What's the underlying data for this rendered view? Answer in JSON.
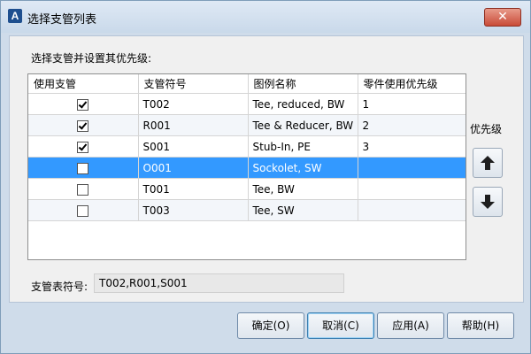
{
  "window": {
    "title": "选择支管列表",
    "app_icon": "autocad-a-icon",
    "close_icon": "close-icon",
    "close_glyph": "✕"
  },
  "dialog": {
    "prompt": "选择支管并设置其优先级:",
    "columns": [
      "使用支管",
      "支管符号",
      "图例名称",
      "零件使用优先级"
    ],
    "rows": [
      {
        "checked": true,
        "symbol": "T002",
        "legend": "Tee, reduced, BW",
        "priority": "1"
      },
      {
        "checked": true,
        "symbol": "R001",
        "legend": "Tee & Reducer, BW",
        "priority": "2"
      },
      {
        "checked": true,
        "symbol": "S001",
        "legend": "Stub-In, PE",
        "priority": "3"
      },
      {
        "checked": false,
        "symbol": "O001",
        "legend": "Sockolet, SW",
        "priority": "",
        "selected": true
      },
      {
        "checked": false,
        "symbol": "T001",
        "legend": "Tee, BW",
        "priority": ""
      },
      {
        "checked": false,
        "symbol": "T003",
        "legend": "Tee, SW",
        "priority": ""
      }
    ],
    "priority_label": "优先级",
    "move_up_icon": "arrow-up-icon",
    "move_down_icon": "arrow-down-icon",
    "symbols_label": "支管表符号:",
    "symbols_value": "T002,R001,S001"
  },
  "buttons": {
    "ok": "确定(O)",
    "cancel": "取消(C)",
    "apply": "应用(A)",
    "help": "帮助(H)"
  },
  "colors": {
    "selection": "#3399ff",
    "title_bar": "#dfe9f5",
    "close_button": "#c94b38"
  }
}
